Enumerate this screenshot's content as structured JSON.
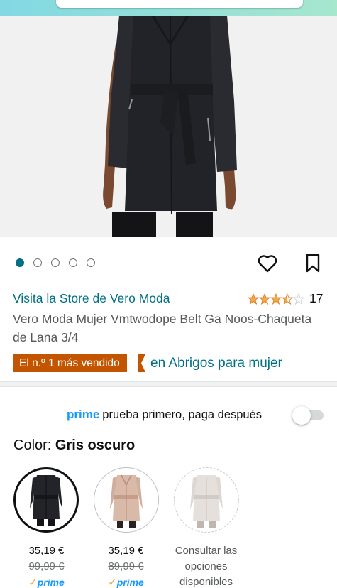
{
  "product": {
    "store_link": "Visita la Store de Vero Moda",
    "title": "Vero Moda Mujer Vmtwodope Belt Ga Noos-Chaqueta de Lana 3/4",
    "rating": 3.5,
    "rating_count": "17",
    "bestseller_badge": "El n.º 1 más vendido",
    "bestseller_category": "en Abrigos para mujer"
  },
  "carousel": {
    "total": 5,
    "active_index": 0
  },
  "icons": {
    "wishlist": "heart-icon",
    "save": "bookmark-icon",
    "star_filled": "star-filled-icon"
  },
  "prime_offer": {
    "prime_word": "prime",
    "text": "prueba primero, paga después",
    "toggle_on": false
  },
  "color": {
    "label": "Color:",
    "selected_name": "Gris oscuro"
  },
  "color_options": [
    {
      "price": "35,19 €",
      "list_price": "99,99 €",
      "prime": "prime",
      "check": "✓"
    },
    {
      "price": "35,19 €",
      "list_price": "89,99 €",
      "prime": "prime",
      "check": "✓"
    },
    {
      "line1": "Consultar las",
      "line2": "opciones",
      "line3": "disponibles"
    }
  ],
  "colors": {
    "accent_teal": "#007185",
    "badge_orange": "#c45500",
    "prime_blue": "#1399ff",
    "star_orange": "#f3a847"
  }
}
